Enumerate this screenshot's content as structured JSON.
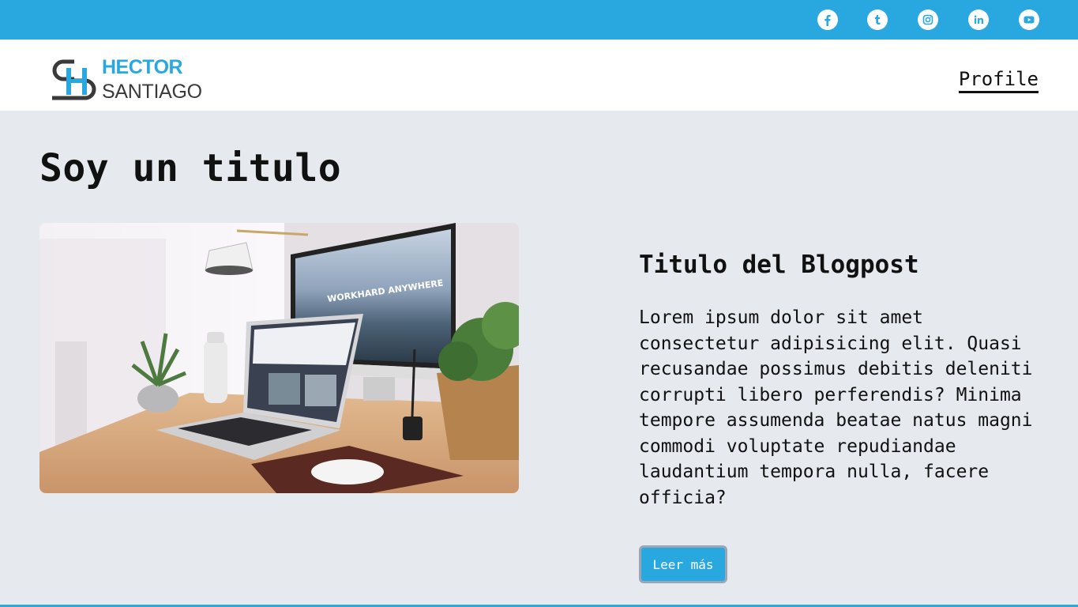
{
  "social": {
    "icons": [
      "facebook-icon",
      "tumblr-icon",
      "instagram-icon",
      "linkedin-icon",
      "youtube-icon"
    ]
  },
  "logo": {
    "first_name": "HECTOR",
    "last_name": "SANTIAGO",
    "brand_color": "#29a8e0"
  },
  "nav": {
    "profile_label": "Profile"
  },
  "main": {
    "title": "Soy un titulo"
  },
  "post": {
    "title": "Titulo del Blogpost",
    "body": "Lorem ipsum dolor sit amet consectetur adipisicing elit. Quasi recusandae possimus debitis deleniti corrupti libero perferendis? Minima tempore assumenda beatae natus magni commodi voluptate repudiandae laudantium tempora nulla, facere officia?",
    "button_label": "Leer más",
    "image_text": "WORKHARD ANYWHERE"
  },
  "colors": {
    "accent": "#29a8e0",
    "background": "#e6e9ee"
  }
}
